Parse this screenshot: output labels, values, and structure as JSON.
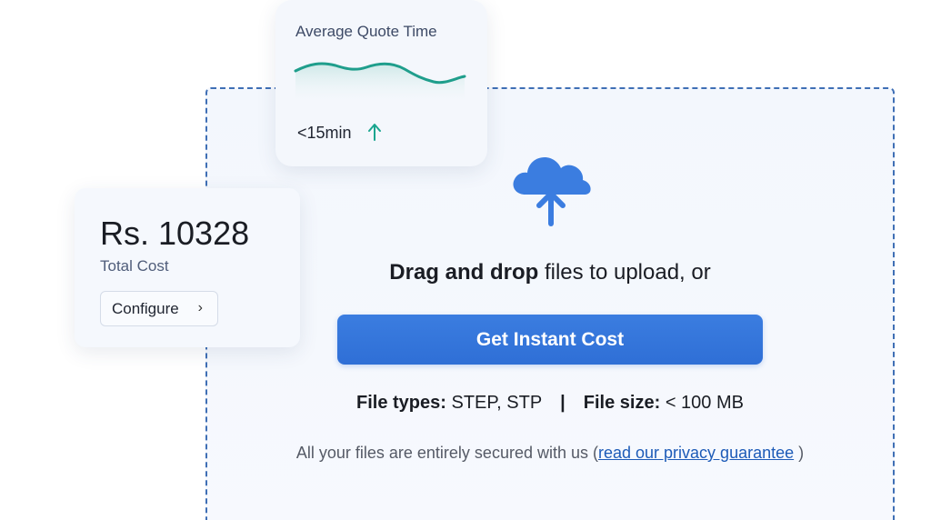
{
  "quote_card": {
    "title": "Average Quote Time",
    "value": "<15min",
    "trend_icon": "arrow-up-icon",
    "trend_color": "#1aa58f",
    "sparkline_color": "#1f9e8c"
  },
  "cost_card": {
    "amount": "Rs. 10328",
    "label": "Total Cost",
    "configure_label": "Configure",
    "configure_icon": "chevron-right-icon"
  },
  "upload": {
    "icon": "cloud-upload-icon",
    "drag_bold": "Drag and drop",
    "drag_rest": " files to upload, or",
    "cta_label": "Get Instant Cost",
    "file_types_label": "File types:",
    "file_types_value": " STEP, STP",
    "separator": "|",
    "file_size_label": "File size:",
    "file_size_value": " < 100 MB",
    "secure_text": "All your files are entirely secured with us (",
    "privacy_link": "read our privacy guarantee",
    "secure_close": " )"
  },
  "colors": {
    "accent": "#2f6fd6",
    "dashed_border": "#3f6fb5",
    "link": "#1d5bb8"
  }
}
